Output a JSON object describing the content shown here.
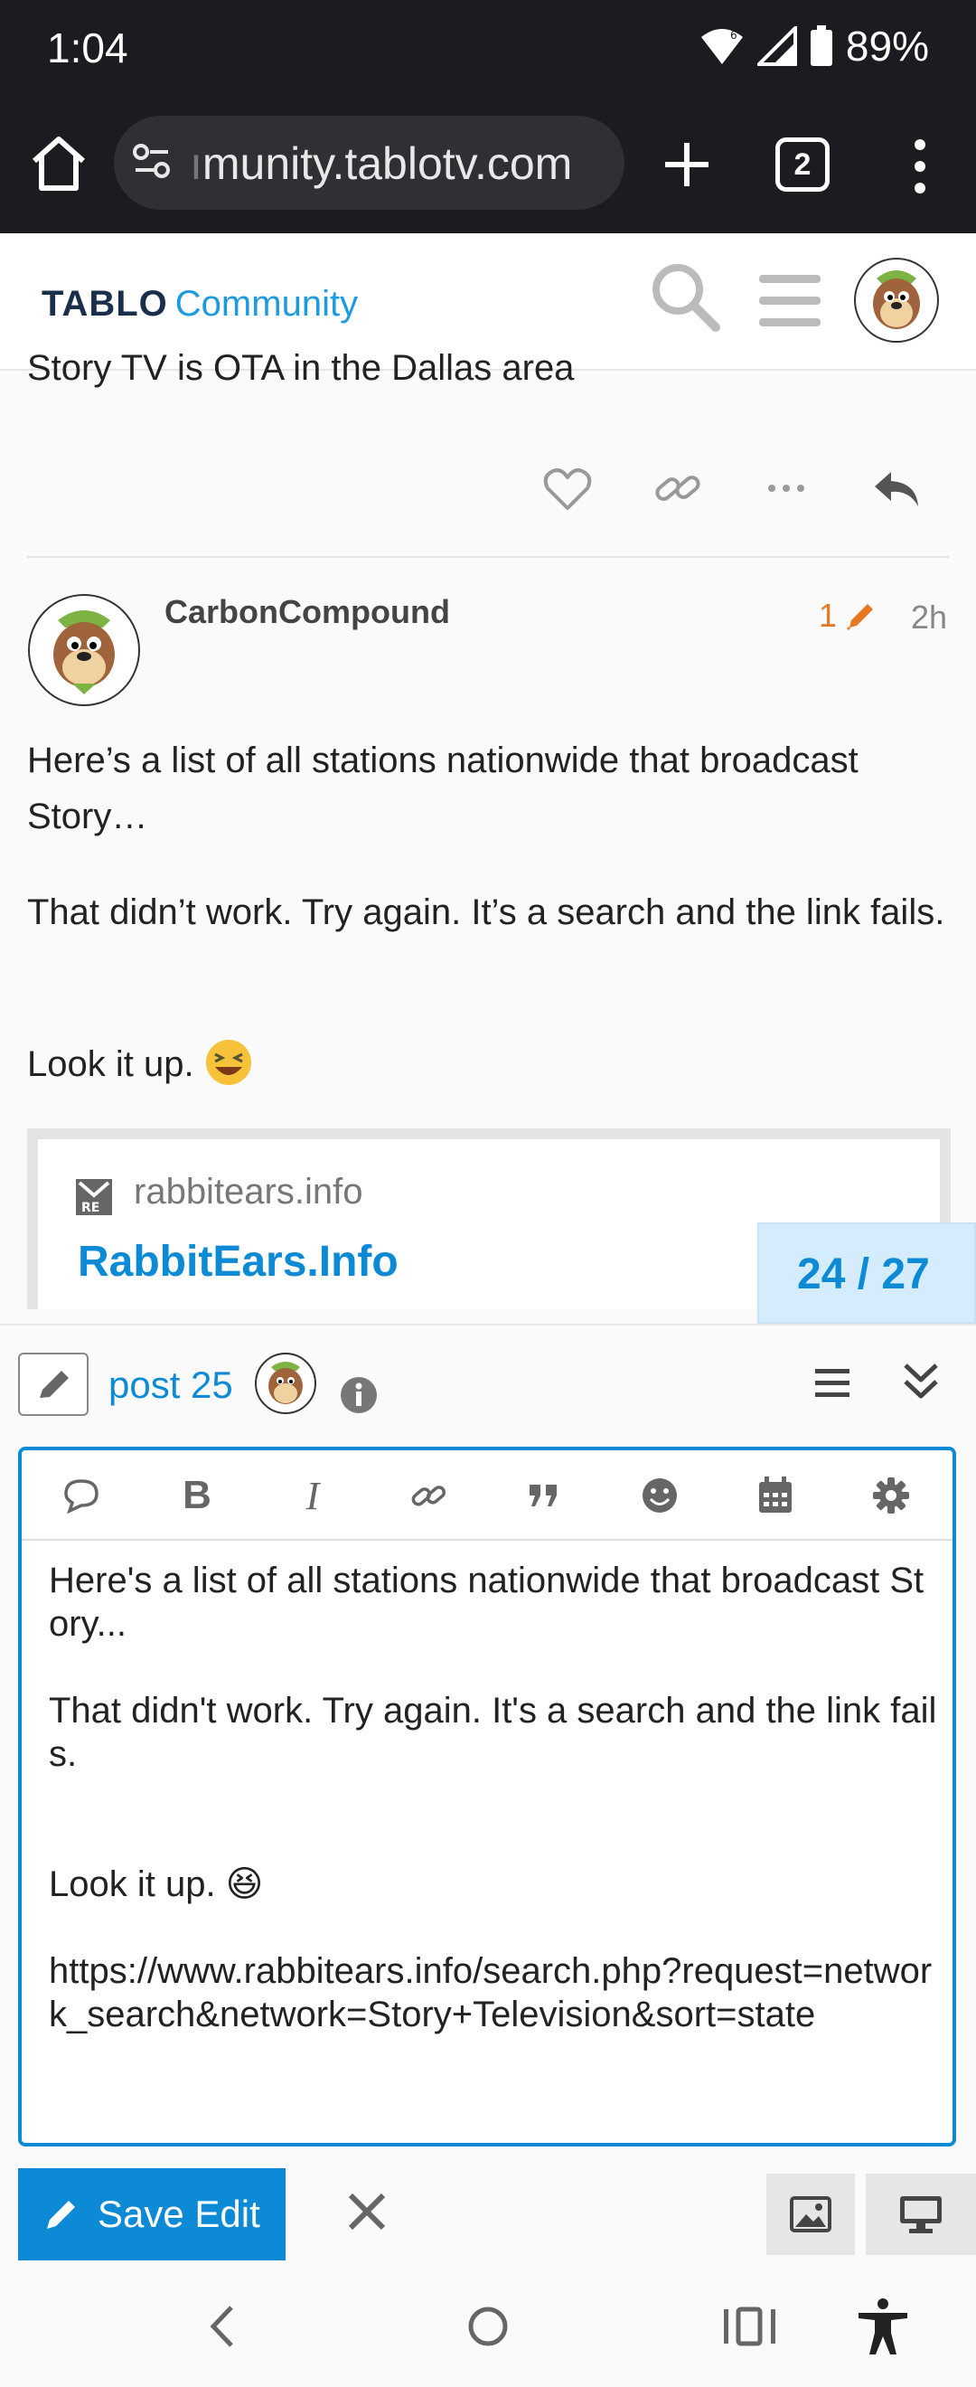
{
  "status_bar": {
    "time": "1:04",
    "battery": "89%"
  },
  "browser": {
    "url_faded": "ı",
    "url": "munity.tablotv.com",
    "tab_count": "2"
  },
  "site": {
    "logo_brand": "TABLO",
    "logo_sub": "Community"
  },
  "thread": {
    "truncated_text": "Story TV is OTA in the Dallas area"
  },
  "post": {
    "username": "CarbonCompound",
    "edit_count": "1",
    "time": "2h",
    "paragraphs": [
      "Here’s a list of all stations nationwide that broadcast Story…",
      "That didn’t work. Try again. It’s a search and the link fails.",
      "Look it up."
    ],
    "onebox": {
      "site": "rabbitears.info",
      "title": "RabbitEars.Info"
    }
  },
  "progress": "24 / 27",
  "composer": {
    "post_ref": "post 25",
    "editor_text": "Here's a list of all stations nationwide that broadcast Story...\n\nThat didn't work. Try again. It's a search and the link fails.\n\n\nLook it up. 😆\n\nhttps://www.rabbitears.info/search.php?request=network_search&network=Story+Television&sort=state",
    "save_label": "Save Edit"
  },
  "colors": {
    "accent": "#0c8ad6",
    "edit": "#e87722",
    "status_bg": "#1b1c1f"
  }
}
